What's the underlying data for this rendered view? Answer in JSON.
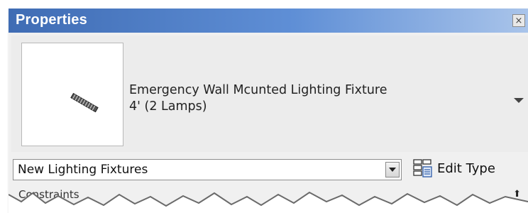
{
  "panel": {
    "title": "Properties",
    "close_glyph": "×"
  },
  "type_selector": {
    "name_line1": "Emergency Wall Mcunted Lighting Fixture",
    "name_line2": "4' (2 Lamps)",
    "preview_icon": "wall-light-fixture-icon"
  },
  "instance_filter": {
    "selected": "New Lighting Fixtures"
  },
  "edit_type": {
    "label": "Edit Type",
    "icon": "edit-type-icon"
  },
  "section": {
    "header": "Constraints",
    "collapse_glyph": "⬆"
  },
  "colors": {
    "title_bar_start": "#3f6cb4",
    "title_bar_end": "#a9c4ea",
    "panel_bg": "#f0f0f0"
  }
}
